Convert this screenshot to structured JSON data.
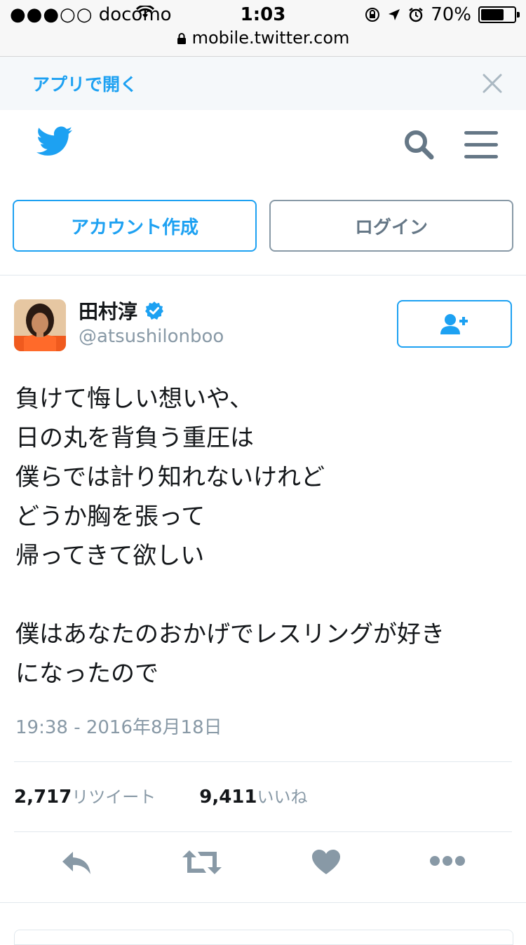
{
  "status_bar": {
    "carrier": "docomo",
    "signal": "●●●○○",
    "time": "1:03",
    "battery": "70%",
    "battery_level": 0.7,
    "url": "mobile.twitter.com"
  },
  "open_app": {
    "label": "アプリで開く"
  },
  "buttons": {
    "signup": "アカウント作成",
    "login": "ログイン"
  },
  "tweet": {
    "display_name": "田村淳",
    "handle": "@atsushilonboo",
    "text": "負けて悔しい想いや、\n日の丸を背負う重圧は\n僕らでは計り知れないけれど\nどうか胸を張って\n帰ってきて欲しい\n\n僕はあなたのおかげでレスリングが好き\nになったので",
    "timestamp": "19:38 - 2016年8月18日",
    "retweets": "2,717",
    "retweets_label": "リツイート",
    "likes": "9,411",
    "likes_label": "いいね"
  },
  "colors": {
    "accent": "#1da1f2",
    "muted": "#8899a6"
  },
  "icons": [
    "wifi-icon",
    "lock-icon",
    "orientation-lock-icon",
    "location-arrow-icon",
    "alarm-icon",
    "battery-icon",
    "close-icon",
    "twitter-bird-icon",
    "search-icon",
    "menu-icon",
    "verified-icon",
    "follow-user-icon",
    "reply-icon",
    "retweet-icon",
    "like-icon",
    "more-icon"
  ]
}
